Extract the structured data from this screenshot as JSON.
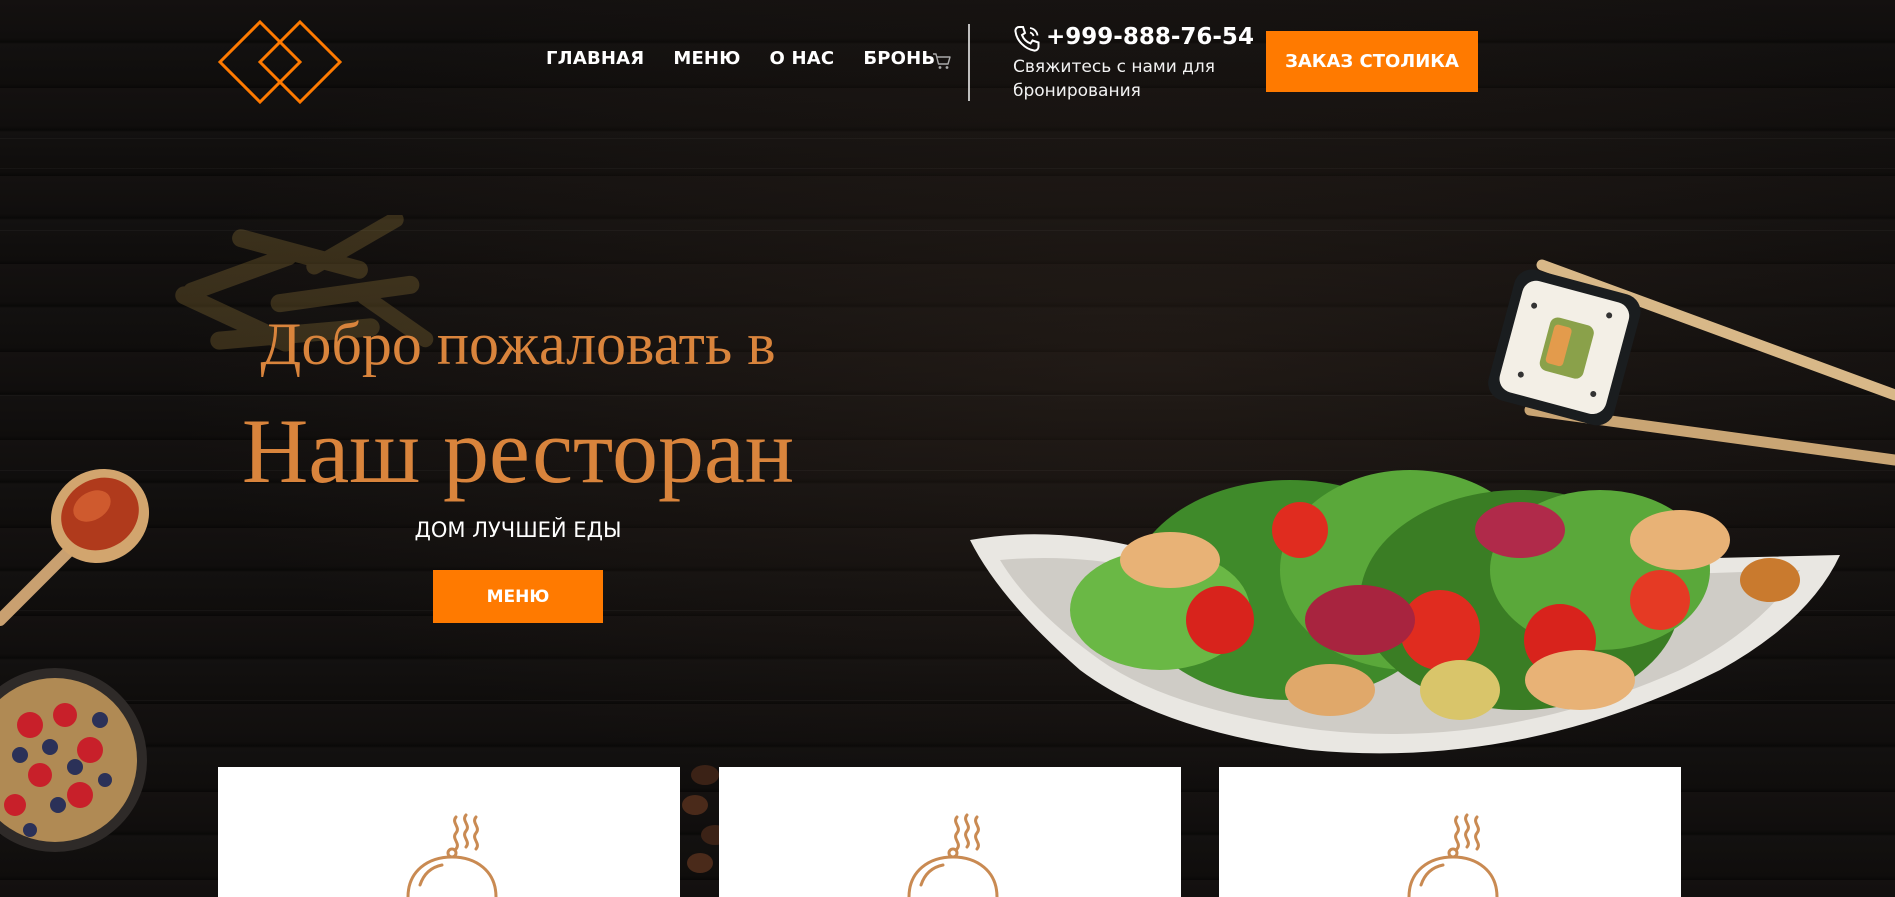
{
  "header": {
    "nav": [
      {
        "label": "ГЛАВНАЯ"
      },
      {
        "label": "МЕНЮ"
      },
      {
        "label": "О НАС"
      },
      {
        "label": "БРОНЬ"
      }
    ],
    "phone": "+999-888-76-54",
    "contact_note": "Свяжитесь с нами для бронирования",
    "reserve_button": "ЗАКАЗ СТОЛИКА"
  },
  "hero": {
    "kicker": "Добро пожаловать в",
    "title": "Наш ресторан",
    "subtitle": "ДОМ ЛУЧШЕЙ ЕДЫ",
    "menu_button": "МЕНЮ"
  },
  "icons": {
    "logo": "double-diamond-logo",
    "cart": "cart-icon",
    "phone": "phone-icon",
    "card": "cloche-icon"
  },
  "colors": {
    "accent": "#ff7a00",
    "heading": "#d9843c",
    "icon": "#c98a52",
    "background": "#0d0b0a"
  }
}
